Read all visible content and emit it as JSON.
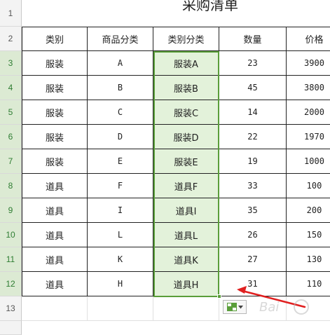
{
  "title": "采购清单",
  "columns": [
    "类别",
    "商品分类",
    "类别分类",
    "数量",
    "价格"
  ],
  "header_row_number": "2",
  "title_row_number": "1",
  "rows": [
    {
      "num": "3",
      "category": "服装",
      "item": "A",
      "combined": "服装A",
      "qty": "23",
      "price": "3900"
    },
    {
      "num": "4",
      "category": "服装",
      "item": "B",
      "combined": "服装B",
      "qty": "45",
      "price": "3800"
    },
    {
      "num": "5",
      "category": "服装",
      "item": "C",
      "combined": "服装C",
      "qty": "14",
      "price": "2000"
    },
    {
      "num": "6",
      "category": "服装",
      "item": "D",
      "combined": "服装D",
      "qty": "22",
      "price": "1970"
    },
    {
      "num": "7",
      "category": "服装",
      "item": "E",
      "combined": "服装E",
      "qty": "19",
      "price": "1000"
    },
    {
      "num": "8",
      "category": "道具",
      "item": "F",
      "combined": "道具F",
      "qty": "33",
      "price": "100"
    },
    {
      "num": "9",
      "category": "道具",
      "item": "I",
      "combined": "道具I",
      "qty": "35",
      "price": "200"
    },
    {
      "num": "10",
      "category": "道具",
      "item": "L",
      "combined": "道具L",
      "qty": "26",
      "price": "150"
    },
    {
      "num": "11",
      "category": "道具",
      "item": "K",
      "combined": "道具K",
      "qty": "27",
      "price": "130"
    },
    {
      "num": "12",
      "category": "道具",
      "item": "H",
      "combined": "道具H",
      "qty": "31",
      "price": "110"
    }
  ],
  "empty_row_number": "13",
  "selection": {
    "column": "类别分类",
    "from_row": "3",
    "to_row": "12"
  },
  "colors": {
    "selection_border": "#5a9e3a",
    "selection_fill": "#e3f2da",
    "arrow": "#e02020"
  },
  "icons": {
    "autofill_options": "auto-fill-options-icon",
    "dropdown": "chevron-down-icon"
  }
}
